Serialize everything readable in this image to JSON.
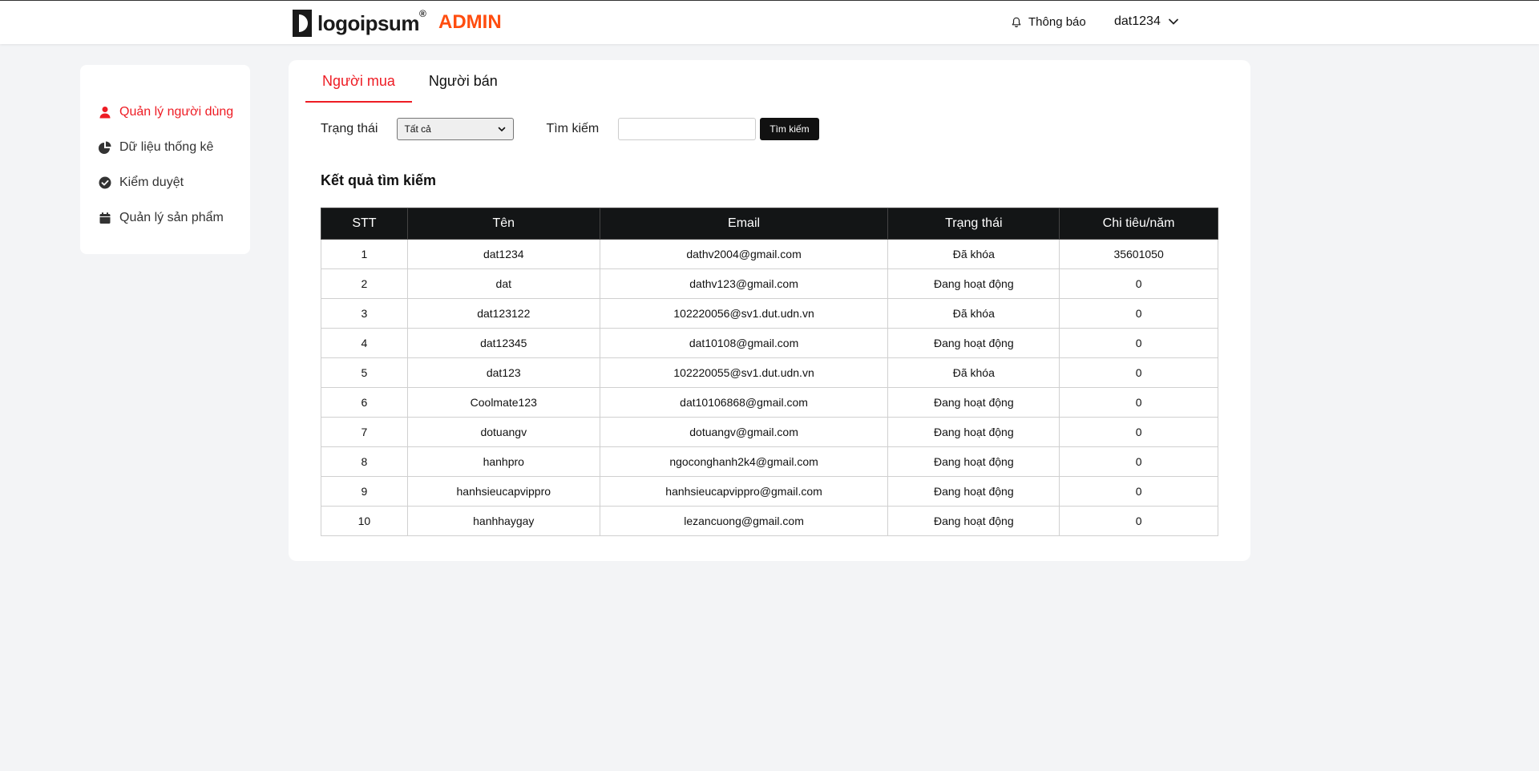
{
  "header": {
    "logo_text": "logoipsum",
    "logo_reg": "®",
    "admin_label": "ADMIN",
    "notification_label": "Thông báo",
    "username": "dat1234",
    "accent_color": "#ff4d0f"
  },
  "sidebar": {
    "items": [
      {
        "label": "Quản lý người dùng",
        "icon": "user-icon",
        "active": true
      },
      {
        "label": "Dữ liệu thống kê",
        "icon": "pie-chart-icon",
        "active": false
      },
      {
        "label": "Kiểm duyệt",
        "icon": "check-circle-icon",
        "active": false
      },
      {
        "label": "Quản lý sản phẩm",
        "icon": "calendar-icon",
        "active": false
      }
    ],
    "active_color": "#ee1c24"
  },
  "main": {
    "tabs": [
      {
        "label": "Người mua",
        "active": true
      },
      {
        "label": "Người bán",
        "active": false
      }
    ],
    "filters": {
      "status_label": "Trạng thái",
      "status_value": "Tất cả",
      "search_label": "Tìm kiếm",
      "search_value": "",
      "search_button": "Tìm kiếm"
    },
    "results_title": "Kết quả tìm kiếm",
    "table": {
      "columns": [
        "STT",
        "Tên",
        "Email",
        "Trạng thái",
        "Chi tiêu/năm"
      ],
      "rows": [
        [
          "1",
          "dat1234",
          "dathv2004@gmail.com",
          "Đã khóa",
          "35601050"
        ],
        [
          "2",
          "dat",
          "dathv123@gmail.com",
          "Đang hoạt động",
          "0"
        ],
        [
          "3",
          "dat123122",
          "102220056@sv1.dut.udn.vn",
          "Đã khóa",
          "0"
        ],
        [
          "4",
          "dat12345",
          "dat10108@gmail.com",
          "Đang hoạt động",
          "0"
        ],
        [
          "5",
          "dat123",
          "102220055@sv1.dut.udn.vn",
          "Đã khóa",
          "0"
        ],
        [
          "6",
          "Coolmate123",
          "dat10106868@gmail.com",
          "Đang hoạt động",
          "0"
        ],
        [
          "7",
          "dotuangv",
          "dotuangv@gmail.com",
          "Đang hoạt động",
          "0"
        ],
        [
          "8",
          "hanhpro",
          "ngoconghanh2k4@gmail.com",
          "Đang hoạt động",
          "0"
        ],
        [
          "9",
          "hanhsieucapvippro",
          "hanhsieucapvippro@gmail.com",
          "Đang hoạt động",
          "0"
        ],
        [
          "10",
          "hanhhaygay",
          "lezancuong@gmail.com",
          "Đang hoạt động",
          "0"
        ]
      ]
    }
  }
}
